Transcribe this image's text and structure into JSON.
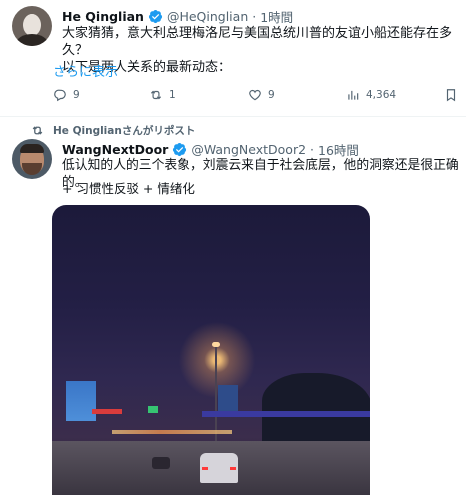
{
  "tweet1": {
    "author_name": "He Qinglian",
    "handle": "@HeQinglian",
    "dot": "·",
    "time": "1時間",
    "text_line1": "大家猜猜，意大利总理梅洛尼与美国总统川普的友谊小船还能存在多久？",
    "text_line2": "以下是两人关系的最新动态：",
    "show_more": "さらに表示",
    "replies": "9",
    "reposts": "1",
    "likes": "9",
    "views": "4,364"
  },
  "repost_banner": "He Qinglianさんがリポスト",
  "tweet2": {
    "author_name": "WangNextDoor",
    "handle": "@WangNextDoor2",
    "dot": "·",
    "time": "16時間",
    "text": "低认知的人的三个表象，刘震云来自于社会底层，他的洞察还是很正确的。",
    "tags": "+ 习惯性反驳 + 情绪化"
  },
  "colors": {
    "accent": "#1d9bf0",
    "muted": "#536471",
    "text": "#0f1419"
  }
}
